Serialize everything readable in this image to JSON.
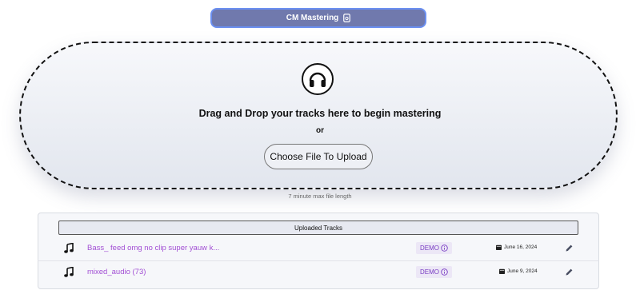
{
  "header": {
    "app_button_label": "CM Mastering"
  },
  "dropzone": {
    "title": "Drag and Drop your tracks here to begin mastering",
    "or_text": "or",
    "choose_button": "Choose File To Upload",
    "note": "7 minute max file length"
  },
  "tracks": {
    "header": "Uploaded Tracks",
    "items": [
      {
        "name": "Bass_ feed omg no clip super yauw k...",
        "badge": "DEMO",
        "date": "June 16, 2024"
      },
      {
        "name": "mixed_audio (73)",
        "badge": "DEMO",
        "date": "June 9, 2024"
      }
    ]
  },
  "colors": {
    "header_bg": "#7079ad",
    "header_border": "#6b8ff0",
    "track_link": "#a24fd4",
    "badge_text": "#7b3fc4",
    "badge_bg": "#ece7f6"
  }
}
